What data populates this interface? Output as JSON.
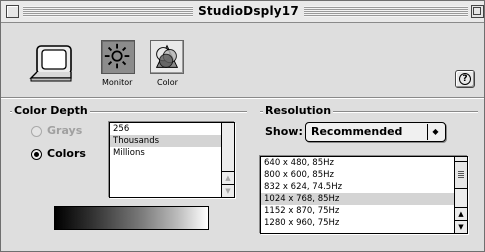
{
  "window": {
    "title": "StudioDsply17"
  },
  "toolbar": {
    "monitor_label": "Monitor",
    "color_label": "Color",
    "help_label": "?"
  },
  "color_depth": {
    "title": "Color Depth",
    "options": [
      {
        "label": "Grays",
        "selected": false,
        "enabled": false
      },
      {
        "label": "Colors",
        "selected": true,
        "enabled": true
      }
    ],
    "list": [
      "256",
      "Thousands",
      "Millions"
    ],
    "selected_item": "Thousands"
  },
  "resolution": {
    "title": "Resolution",
    "show_label": "Show:",
    "show_value": "Recommended",
    "list": [
      "640 x 480, 85Hz",
      "800 x 600, 85Hz",
      "832 x 624, 74.5Hz",
      "1024 x 768, 85Hz",
      "1152 x 870, 75Hz",
      "1280 x 960, 75Hz"
    ],
    "selected_item": "1024 x 768, 85Hz"
  },
  "icons": {
    "monitor_large": "monitor-icon",
    "monitor_tab": "sun-brightness-icon",
    "color_tab": "color-wheel-icon",
    "help": "help-icon"
  }
}
